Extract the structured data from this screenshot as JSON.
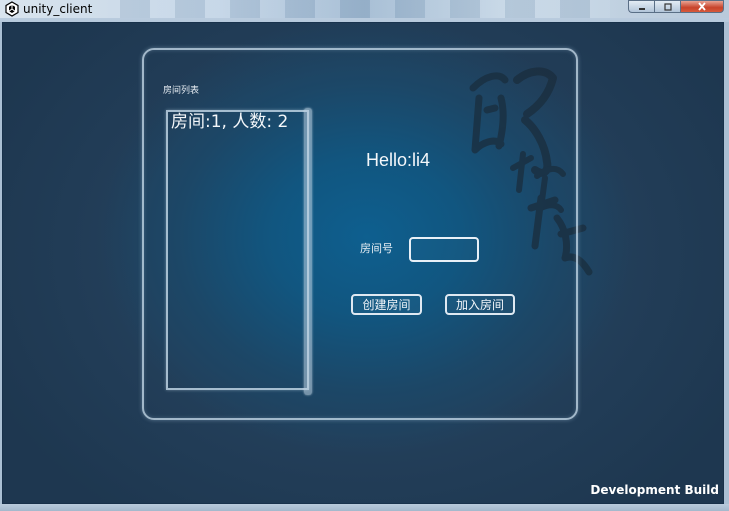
{
  "window": {
    "title": "unity_client",
    "controls": {
      "minimize_icon": "minimize-icon",
      "maximize_icon": "maximize-icon",
      "close_icon": "close-icon"
    }
  },
  "lobby": {
    "room_list_title": "房间列表",
    "rooms": [
      {
        "label": "房间:1, 人数: 2"
      }
    ],
    "greeting": "Hello:li4",
    "room_number_label": "房间号",
    "room_number_value": "",
    "create_room_label": "创建房间",
    "join_room_label": "加入房间"
  },
  "footer": {
    "build_label": "Development Build"
  },
  "colors": {
    "background_center": "#0e5f8f",
    "background_edge": "#233f5a",
    "panel_border": "#cde1f0",
    "text": "#f4f7fa"
  }
}
